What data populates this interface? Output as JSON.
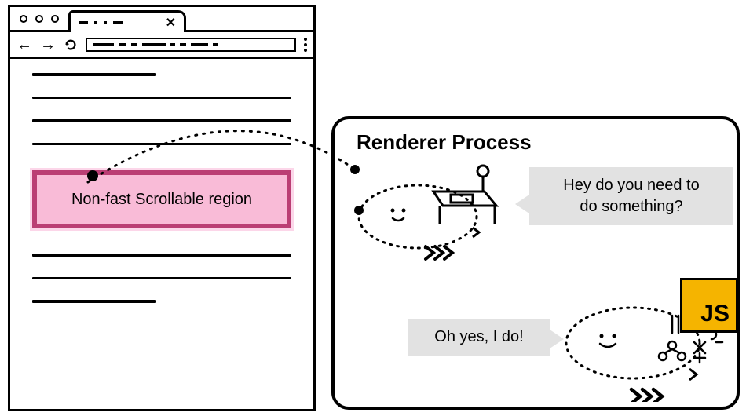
{
  "browserWindow": {
    "tab": {
      "closeGlyph": "✕"
    },
    "nav": {
      "back": "←",
      "forward": "→"
    },
    "page": {
      "regionLabel": "Non-fast Scrollable region"
    }
  },
  "rendererBox": {
    "title": "Renderer Process",
    "speech1_line1": "Hey do you need to",
    "speech1_line2": "do something?",
    "speech2": "Oh yes, I do!",
    "jsBadge": "JS"
  }
}
